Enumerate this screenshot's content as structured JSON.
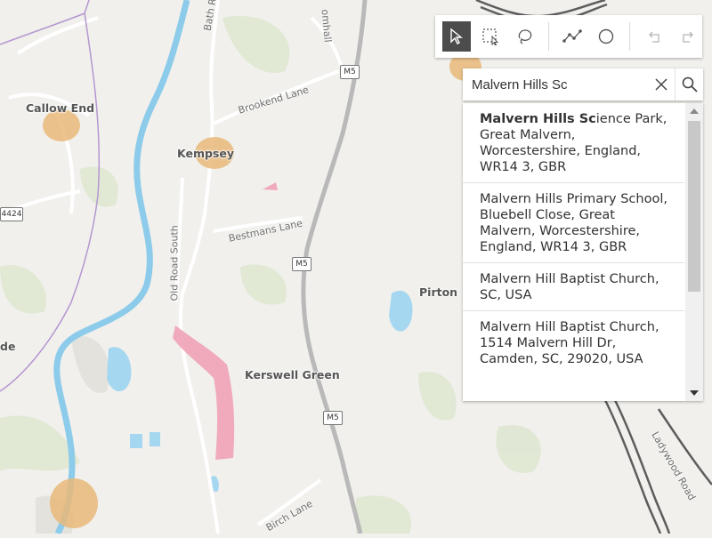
{
  "colors": {
    "land": "#f1f0ec",
    "water": "#a6d7f0",
    "river": "#8ccbea",
    "green": "#dfe8d3",
    "motorway": "#b9b9b9",
    "dual_carriageway": "#5d5d5d",
    "boundary": "#b497d1",
    "highlight_orange": "#e9b979",
    "highlight_pink": "#f0a2b7",
    "toolbar_active": "#4c4c4c"
  },
  "map": {
    "place_labels": [
      "Callow End",
      "Kempsey",
      "Pirton",
      "Kerswell Green",
      "de"
    ],
    "road_labels": [
      "Bath R",
      "Brookend Lane",
      "Bestmans Lane",
      "Old Road South",
      "Birch Lane",
      "Ladywood Road",
      "omhall"
    ],
    "shields": [
      "M5",
      "M5",
      "M5",
      "4424"
    ]
  },
  "toolbar": {
    "tools": [
      {
        "name": "select-tool",
        "icon": "cursor-arrow-icon",
        "active": true
      },
      {
        "name": "rectangle-select-tool",
        "icon": "dashed-rectangle-icon",
        "active": false
      },
      {
        "name": "lasso-select-tool",
        "icon": "lasso-icon",
        "active": false
      },
      {
        "name": "polyline-tool",
        "icon": "polyline-icon",
        "active": false
      },
      {
        "name": "circle-tool",
        "icon": "circle-icon",
        "active": false
      },
      {
        "name": "undo-tool",
        "icon": "undo-icon",
        "active": false
      },
      {
        "name": "redo-tool",
        "icon": "redo-icon",
        "active": false
      }
    ]
  },
  "search": {
    "value": "Malvern Hills Sc",
    "clear_icon": "close-icon",
    "search_icon": "search-icon"
  },
  "suggestions": [
    {
      "match": "Malvern Hills Sc",
      "rest": "ience Park, Great Malvern, Worcestershire, England, WR14 3, GBR"
    },
    {
      "match": "",
      "rest": "Malvern Hills Primary School, Bluebell Close, Great Malvern, Worcestershire, England, WR14 3, GBR"
    },
    {
      "match": "",
      "rest": "Malvern Hill Baptist Church, SC, USA"
    },
    {
      "match": "",
      "rest": "Malvern Hill Baptist Church, 1514 Malvern Hill Dr, Camden, SC, 29020, USA"
    }
  ]
}
